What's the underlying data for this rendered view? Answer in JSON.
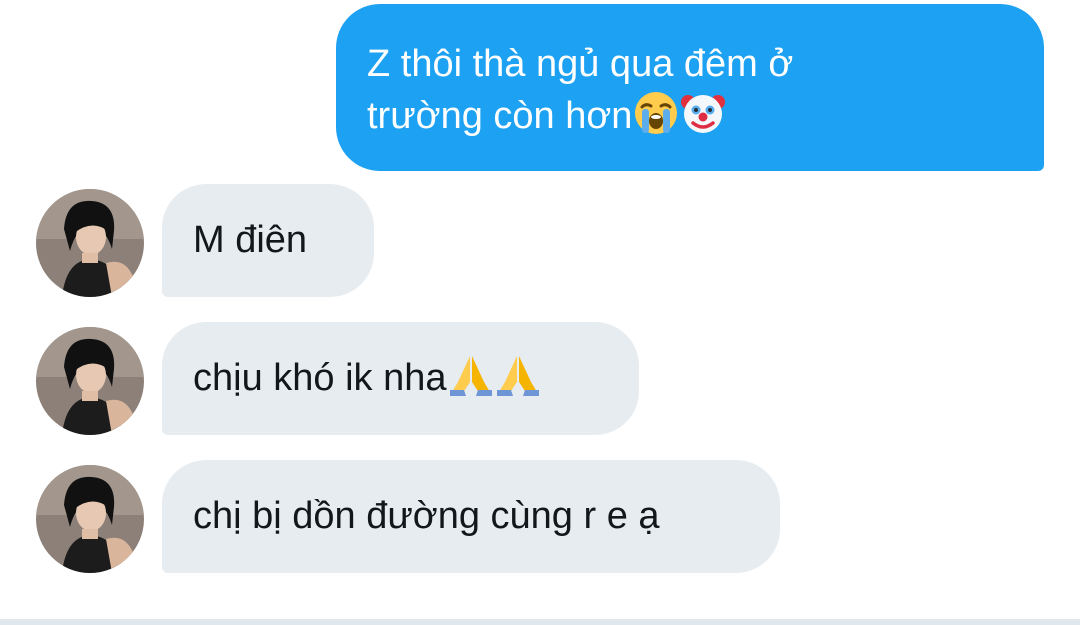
{
  "conversation": {
    "outgoing": [
      {
        "text": "Z thôi thà ngủ qua đêm ở\ntrường còn hơn",
        "emojis": [
          "loudly-crying-face",
          "clown-face"
        ]
      }
    ],
    "incoming": [
      {
        "text": "M điên",
        "emojis": []
      },
      {
        "text": "chịu khó ik nha",
        "emojis": [
          "folded-hands",
          "folded-hands"
        ]
      },
      {
        "text": "chị bị dồn đường cùng r e ạ",
        "emojis": []
      }
    ]
  },
  "colors": {
    "outgoing_bubble": "#1da1f2",
    "incoming_bubble": "#e6ecf0",
    "incoming_text": "#14171a",
    "outgoing_text": "#ffffff"
  }
}
